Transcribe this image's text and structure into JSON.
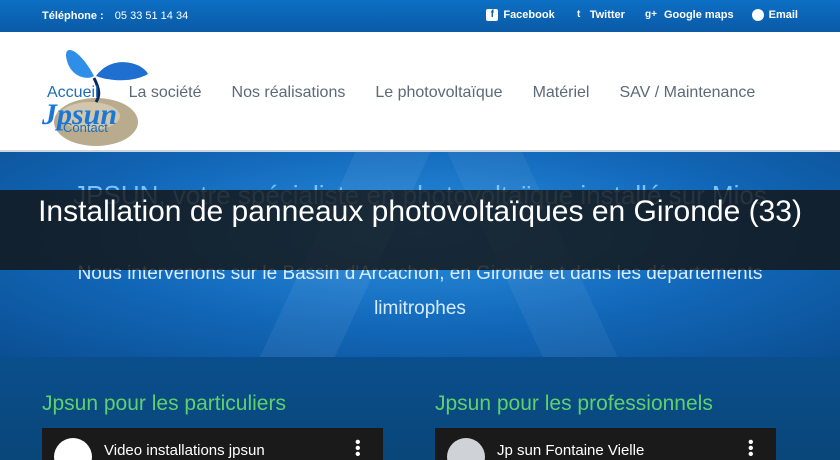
{
  "topbar": {
    "phone_label": "Téléphone :",
    "phone_number": "05 33 51 14 34",
    "links": [
      {
        "label": "Facebook",
        "icon": "facebook-icon"
      },
      {
        "label": "Twitter",
        "icon": "twitter-icon"
      },
      {
        "label": "Google maps",
        "icon": "google-plus-icon"
      },
      {
        "label": "Email",
        "icon": "chat-bubble-icon"
      }
    ]
  },
  "header": {
    "logo_text": "Jpsun",
    "nav": [
      "Accueil",
      "La société",
      "Nos réalisations",
      "Le photovoltaïque",
      "Matériel",
      "SAV / Maintenance"
    ],
    "contact": "Contact"
  },
  "hero": {
    "heading": "JPSUN, votre spécialiste en photovoltaïque installé sur Mios",
    "subtext": "Nous intervenons sur le Bassin d'Arcachon, en Gironde et dans les départements limitrophes"
  },
  "banner": {
    "title": "Installation de panneaux photovoltaïques en Gironde (33)"
  },
  "sections": {
    "particuliers_title": "Jpsun pour les particuliers",
    "professionnels_title": "Jpsun pour les professionnels",
    "video_left_title": "Video installations jpsun",
    "video_right_title": "Jp sun Fontaine Vielle"
  },
  "colors": {
    "accent_blue": "#1b6db8",
    "green_title": "#5fd06b",
    "hero_heading": "#7ec3ff"
  }
}
